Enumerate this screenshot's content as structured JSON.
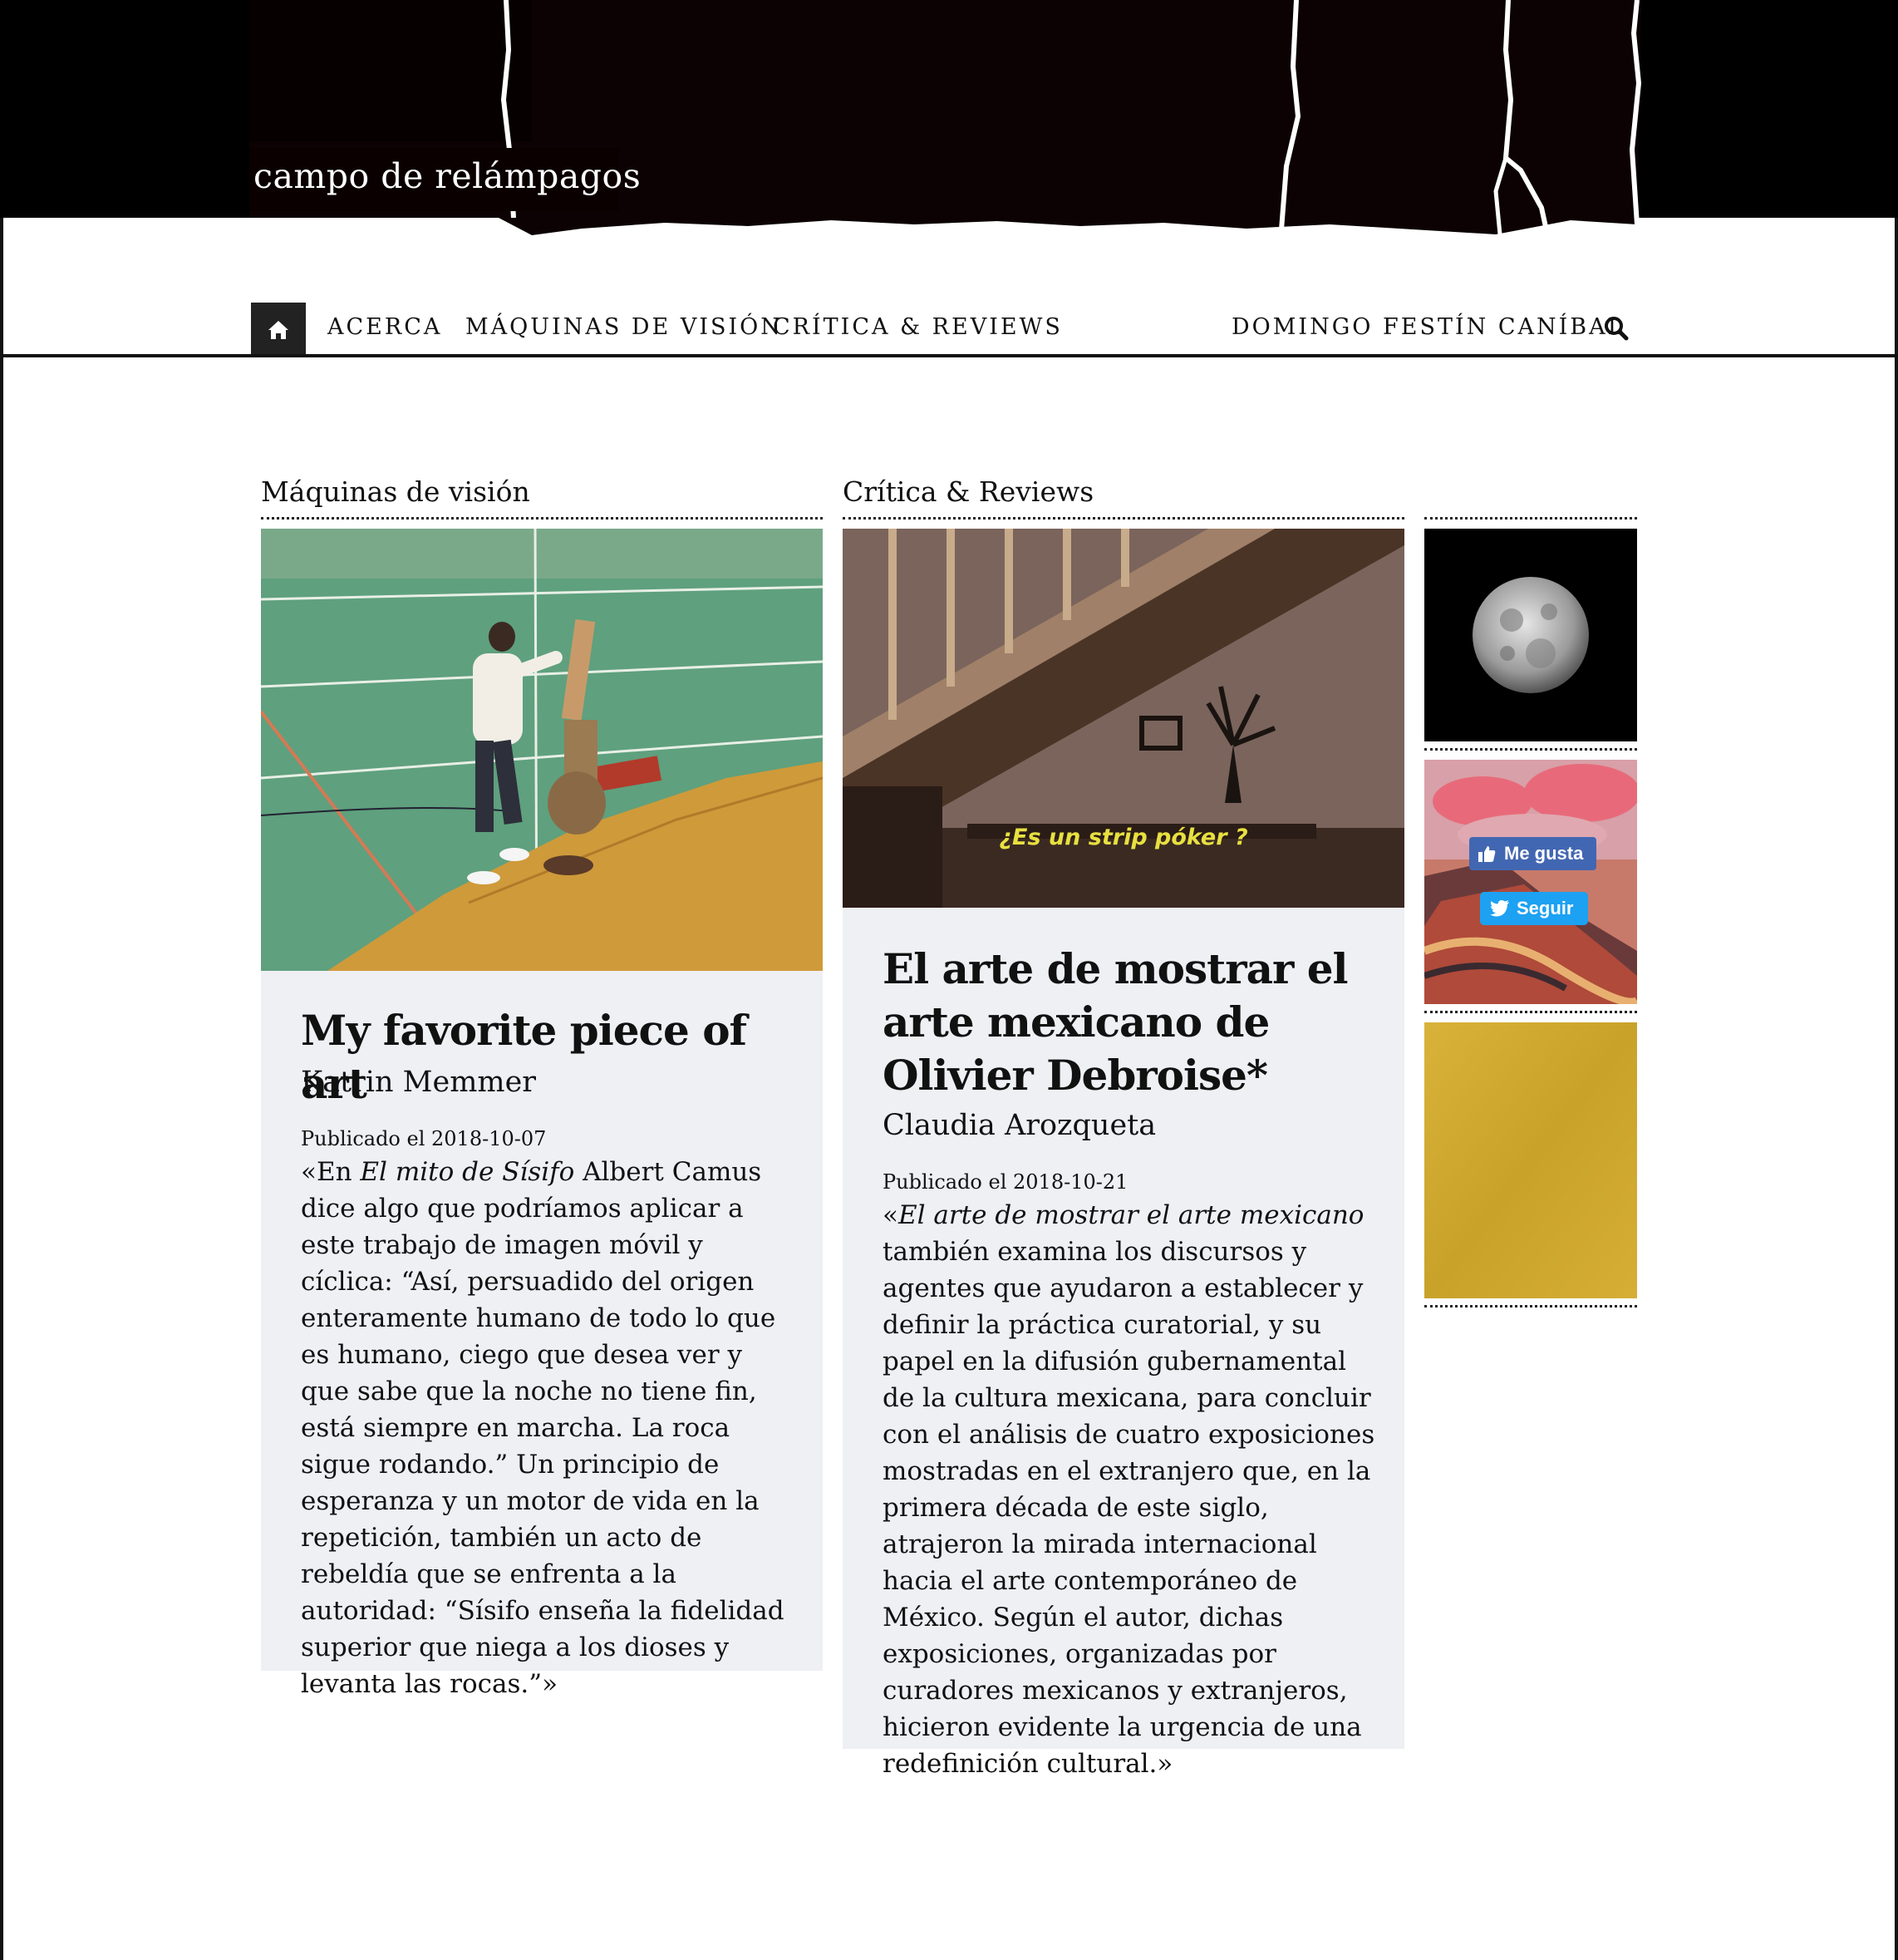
{
  "site": {
    "title": "campo de relámpagos"
  },
  "nav": {
    "home_icon": "home-icon",
    "items": [
      {
        "label": "ACERCA"
      },
      {
        "label": "MÁQUINAS DE VISIÓN"
      },
      {
        "label": "CRÍTICA & REVIEWS"
      },
      {
        "label": "DOMINGO FESTÍN CANÍBAL"
      }
    ],
    "search_icon": "search-icon"
  },
  "sections": [
    {
      "heading": "Máquinas de visión",
      "post": {
        "title": "My favorite piece of art",
        "author": "Katrin Memmer",
        "date": "Publicado el 2018-10-07",
        "excerpt_prefix": "«En ",
        "excerpt_italic": "El mito de Sísifo",
        "excerpt_rest": " Albert Camus dice algo que podríamos aplicar a este trabajo de imagen móvil y cíclica: “Así, persuadido del origen enteramente humano de todo lo que es humano, ciego que desea ver y que sabe que la noche no tiene fin, está siempre en marcha. La roca sigue rodando.” Un principio de esperanza y un motor de vida en la repetición, también un acto de rebeldía que se enfrenta a la autoridad: “Sísifo enseña la fidelidad superior que niega a los dioses y levanta las rocas.”»"
      }
    },
    {
      "heading": "Crítica & Reviews",
      "post": {
        "title": "El arte de mostrar el arte mexicano de Olivier Debroise*",
        "author": "Claudia Arozqueta",
        "date": "Publicado el 2018-10-21",
        "image_caption": "¿Es un strip póker ?",
        "excerpt_prefix": "«",
        "excerpt_italic": "El arte de mostrar el arte mexicano",
        "excerpt_rest": " también examina los discursos y agentes que ayudaron a establecer y definir la práctica curatorial, y su papel en la difusión gubernamental de la cultura mexicana, para concluir con el análisis de cuatro exposiciones mostradas en el extranjero que, en la primera década de este siglo, atrajeron la mirada internacional hacia el arte contemporáneo de México. Según el autor, dichas exposiciones, organizadas por curadores mexicanos y extranjeros, hicieron evidente la urgencia de una redefinición cultural.»"
      }
    }
  ],
  "sidebar": {
    "facebook_label": "Me gusta",
    "twitter_label": "Seguir"
  },
  "colors": {
    "card_bg": "#eef0f4",
    "facebook_blue": "#4267b2",
    "twitter_blue": "#1da1f2",
    "nav_home_bg": "#222222",
    "gold": "#d4a92c"
  }
}
